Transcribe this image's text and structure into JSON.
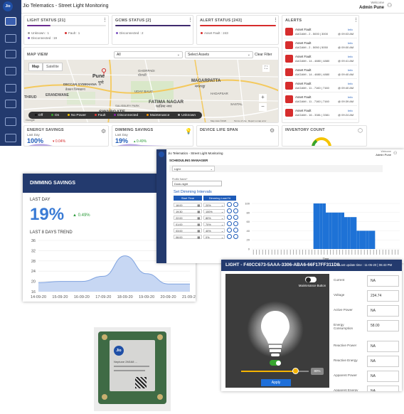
{
  "app": {
    "title": "Jio Telematics - Street Light Monitoring",
    "welcome": "Welcome",
    "user": "Admin Pune",
    "logo": "Jio"
  },
  "light_status": {
    "title": "LIGHT STATUS [21]",
    "menu": "⋮",
    "items": [
      "Unknown : 1",
      "Fault : 1",
      "Disconnected : 19"
    ],
    "colors": [
      "#9e9e9e",
      "#d62c2c",
      "#7e57c2"
    ]
  },
  "gcms_status": {
    "title": "GCMS STATUS [2]",
    "menu": "⋮",
    "items": [
      "Disconnected : 2"
    ]
  },
  "alert_status": {
    "title": "ALERT STATUS [243]",
    "menu": "⋮",
    "items": [
      "Asset Fault : 243"
    ]
  },
  "alerts": {
    "title": "ALERTS",
    "menu": "⋮",
    "items": [
      {
        "type": "Asset Fault",
        "asset": "AAGAMI - 2 - 5000 | 3000",
        "tag": "Info",
        "time": "@ 09:03 AM"
      },
      {
        "type": "Asset Fault",
        "asset": "AAGAMI - 2 - 5050 | 5050",
        "tag": "Info",
        "time": "@ 09:00 AM"
      },
      {
        "type": "Asset Fault",
        "asset": "AAGAMI - 14 - 4880 | 4880",
        "tag": "Info",
        "time": "@ 09:41 AM"
      },
      {
        "type": "Asset Fault",
        "asset": "AAGAMI - 14 - 4880 | 4880",
        "tag": "Info",
        "time": "@ 09:40 AM"
      },
      {
        "type": "Asset Fault",
        "asset": "AAGAMI - 11 - 7160 | 7160",
        "tag": "Info",
        "time": "@ 09:40 AM"
      },
      {
        "type": "Asset Fault",
        "asset": "AAGAMI - 11 - 7160 | 7160",
        "tag": "Info",
        "time": "@ 09:39 AM"
      },
      {
        "type": "Asset Fault",
        "asset": "AAGAMI - 16 - 3381 | 3381",
        "tag": "Info",
        "time": "@ 09:24 AM"
      }
    ]
  },
  "map": {
    "title": "MAP VIEW",
    "filter_all": "All",
    "select_assets": "Select Assets",
    "clear_filter": "Clear Filter",
    "map_btn": "Map",
    "satellite_btn": "Satellite",
    "places": [
      "DECCAN GYMKHANA",
      "डेक्कन जिमखाना",
      "ERANDWANE",
      "THRUD",
      "पुणे",
      "Pune",
      "GHORPADI",
      "घोरपडी",
      "MAGARPATTA",
      "मगरपट्टा",
      "UDAY BAUG",
      "FATIMA NAGAR",
      "फातिमा नगर",
      "SWARGATE",
      "SALISBURY PARK",
      "HADAPSAR",
      "SASTAL",
      "Google",
      "Map data ©2020",
      "Terms of Use",
      "Report a map error"
    ],
    "zoom_in": "+",
    "zoom_out": "−",
    "fullscreen": "⛶",
    "legend": [
      {
        "label": "Off",
        "color": "#111111"
      },
      {
        "label": "On",
        "color": "#37a52f"
      },
      {
        "label": "No Power",
        "color": "#f5c400"
      },
      {
        "label": "Fault",
        "color": "#e53935"
      },
      {
        "label": "Disconnected",
        "color": "#8e24aa"
      },
      {
        "label": "Maintenance",
        "color": "#ff9800"
      },
      {
        "label": "Unknown",
        "color": "#bdbdbd"
      }
    ]
  },
  "energy": {
    "title": "ENERGY SAVINGS",
    "sub": "Last Day",
    "value": "100%",
    "delta": "▾ 0.04%"
  },
  "dimming_small": {
    "title": "DIMMING SAVINGS",
    "sub": "Last Day",
    "value": "19%",
    "delta": "▴ 0.49%"
  },
  "life": {
    "title": "DEVICE LIFE SPAN"
  },
  "inventory": {
    "title": "INVENTORY COUNT"
  },
  "dimming": {
    "title": "DIMMING SAVINGS",
    "last_day": "LAST DAY",
    "value": "19%",
    "delta": "0.49%",
    "trend_title": "LAST 8 DAYS TREND",
    "yticks": [
      "36",
      "32",
      "28",
      "24",
      "20",
      "16"
    ],
    "xticks": [
      "14-09-20",
      "15-09-20",
      "16-09-20",
      "17-09-20",
      "18-09-20",
      "19-09-20",
      "20-09-20",
      "21-09-20"
    ]
  },
  "chart_data": [
    {
      "type": "area",
      "title": "LAST 8 DAYS TREND",
      "x": [
        "14-09-20",
        "15-09-20",
        "16-09-20",
        "17-09-20",
        "18-09-20",
        "19-09-20",
        "20-09-20",
        "21-09-20"
      ],
      "values": [
        19.5,
        20,
        20,
        22,
        30,
        23,
        19,
        19
      ],
      "ylim": [
        16,
        36
      ]
    },
    {
      "type": "bar",
      "x_count": 48,
      "values": [
        0,
        0,
        0,
        0,
        0,
        0,
        0,
        0,
        0,
        0,
        0,
        0,
        0,
        0,
        0,
        0,
        0,
        0,
        0,
        0,
        0,
        0,
        0,
        0,
        0,
        0,
        0,
        0,
        0,
        0,
        0,
        0,
        0,
        0,
        0,
        0,
        0,
        0,
        0,
        0,
        0,
        0,
        0,
        0,
        0,
        0,
        0,
        0
      ],
      "ylim": [
        0,
        100
      ],
      "yticks": [
        "100",
        "80",
        "60",
        "40",
        "20",
        "0"
      ],
      "xlabel": "Time"
    }
  ],
  "sched": {
    "app_title": "Jio Telematics - Street Light Monitoring",
    "welcome": "Welcome",
    "user": "Admin Pune",
    "section": "SCHEDULING MANAGER",
    "type": "Light",
    "profile_label": "Profile Name*",
    "profile": "Dusk-night",
    "intervals_title": "Set Dimming Intervals",
    "col_start": "Start Time",
    "col_load": "Dimming Load %",
    "rows": [
      {
        "t": "18:00",
        "p": "20%"
      },
      {
        "t": "19:30",
        "p": "100%"
      },
      {
        "t": "22:00",
        "p": "80%"
      },
      {
        "t": "01:00",
        "p": "70%"
      },
      {
        "t": "03:00",
        "p": "40%"
      },
      {
        "t": "06:00",
        "p": "0%"
      }
    ],
    "bars": [
      0,
      0,
      0,
      0,
      0,
      0,
      0,
      0,
      0,
      0,
      0,
      0,
      0,
      0,
      0,
      0,
      0,
      0,
      0,
      0,
      100,
      100,
      100,
      100,
      80,
      80,
      80,
      80,
      80,
      80,
      70,
      70,
      70,
      70,
      40,
      40,
      40,
      40,
      40,
      40,
      0,
      0,
      0,
      0,
      0,
      0,
      0,
      0
    ],
    "chart_ticks": [
      "100",
      "80",
      "60",
      "40",
      "20",
      "0"
    ],
    "chart_xlabel": "Time"
  },
  "light": {
    "title": "LIGHT - F40CC673-5AAA-3306-ABA6-66F17FF311D8",
    "last_update": "Last update time : 11-05-20 | 06:43 PM",
    "maintenance": "Maintenance Button",
    "dim": "80%",
    "apply": "Apply",
    "fields": [
      {
        "label": "Current",
        "value": "NA"
      },
      {
        "label": "Voltage",
        "value": "234.74"
      },
      {
        "label": "Active Power",
        "value": "NA"
      },
      {
        "label": "Energy Consumption",
        "value": "58.00"
      },
      {
        "label": "Reactive Power",
        "value": "NA"
      },
      {
        "label": "Reactive Energy",
        "value": "NA"
      },
      {
        "label": "Apparent Power",
        "value": "NA"
      },
      {
        "label": "Apparent Energy",
        "value": "NA"
      }
    ]
  },
  "device": {
    "brand": "Jio",
    "text": "Neptune 2M168 ...",
    "text2": "..."
  }
}
